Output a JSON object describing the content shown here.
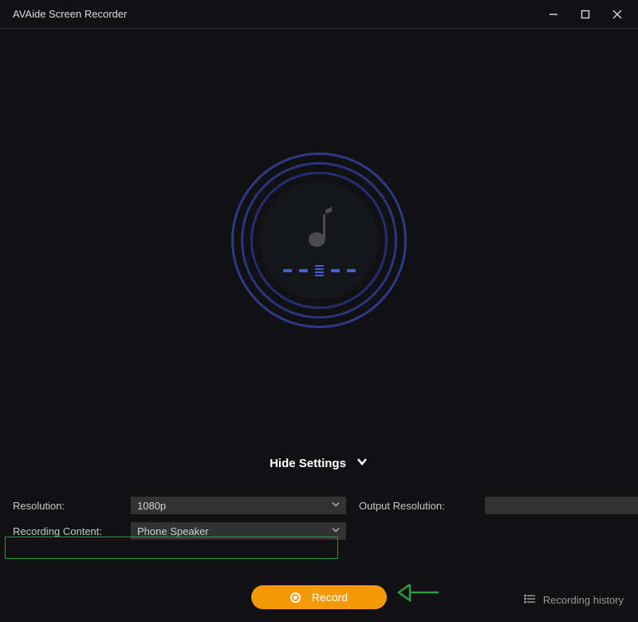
{
  "titlebar": {
    "title": "AVAide Screen Recorder"
  },
  "toggle": {
    "label": "Hide Settings"
  },
  "settings": {
    "resolution_label": "Resolution:",
    "resolution_value": "1080p",
    "output_resolution_label": "Output Resolution:",
    "output_resolution_value": "",
    "recording_content_label": "Recording Content:",
    "recording_content_value": "Phone Speaker"
  },
  "actions": {
    "record_label": "Record",
    "history_label": "Recording history"
  }
}
